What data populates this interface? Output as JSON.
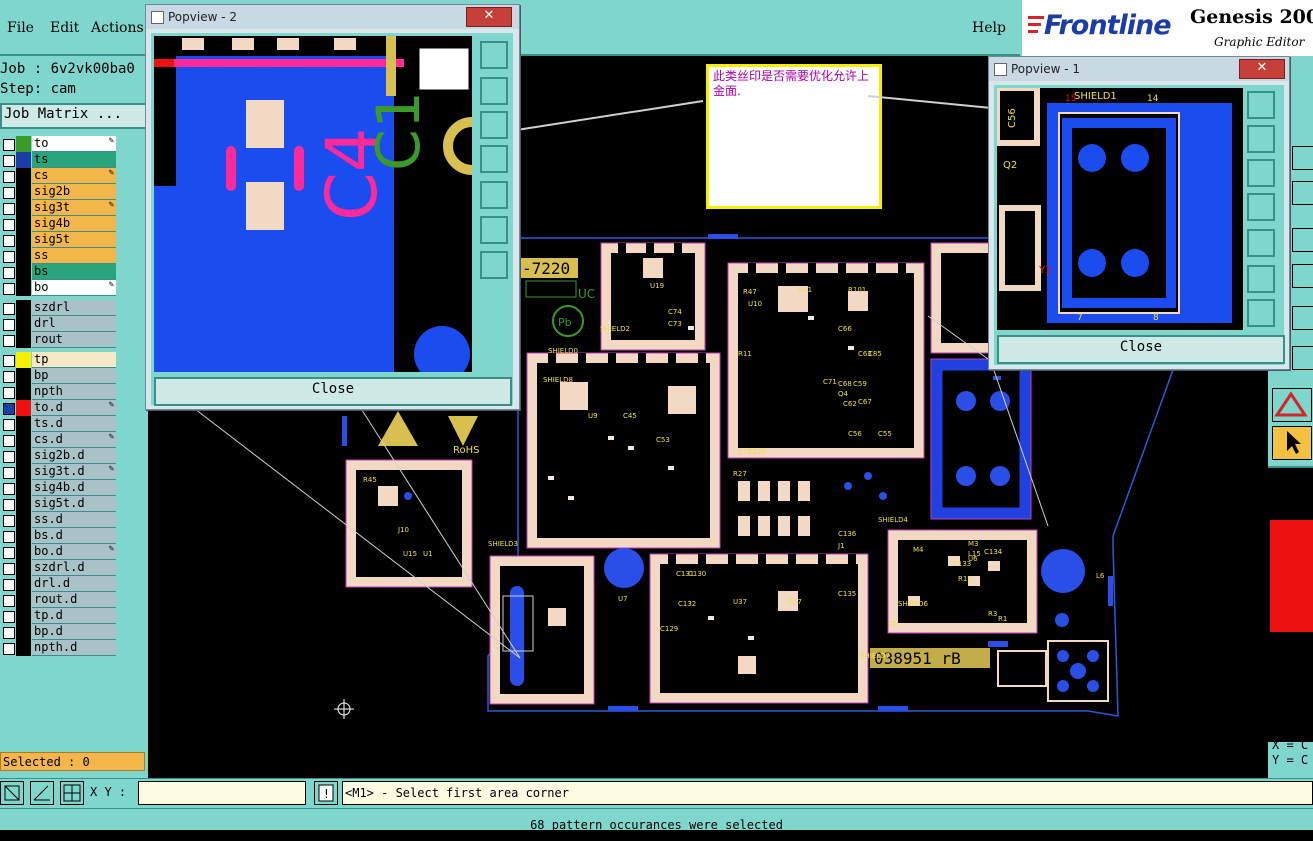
{
  "menu": {
    "file": "File",
    "edit": "Edit",
    "actions": "Actions",
    "help": "Help"
  },
  "brand": {
    "logo": "Frontline",
    "product": "Genesis 200",
    "subtitle": "Graphic Editor"
  },
  "job": {
    "job_line": "Job : 6v2vk00ba0",
    "step_line": "Step: cam",
    "matrix_button": "Job Matrix ..."
  },
  "layers": [
    {
      "name": "to",
      "color": "#3a9a2a",
      "bg": "#ffffff",
      "flag": "✎"
    },
    {
      "name": "ts",
      "color": "#1a3da8",
      "bg": "#2aa47a",
      "flag": ""
    },
    {
      "name": "cs",
      "color": "",
      "bg": "#f2b64a",
      "flag": "✎"
    },
    {
      "name": "sig2b",
      "color": "",
      "bg": "#f2b64a",
      "flag": ""
    },
    {
      "name": "sig3t",
      "color": "",
      "bg": "#f2b64a",
      "flag": "✎"
    },
    {
      "name": "sig4b",
      "color": "",
      "bg": "#f2b64a",
      "flag": ""
    },
    {
      "name": "sig5t",
      "color": "",
      "bg": "#f2b64a",
      "flag": ""
    },
    {
      "name": "ss",
      "color": "",
      "bg": "#f2b64a",
      "flag": ""
    },
    {
      "name": "bs",
      "color": "",
      "bg": "#2aa47a",
      "flag": ""
    },
    {
      "name": "bo",
      "color": "",
      "bg": "#ffffff",
      "flag": "✎"
    },
    {
      "name": "szdrl",
      "color": "",
      "bg": "#a9c2c8",
      "flag": ""
    },
    {
      "name": "drl",
      "color": "",
      "bg": "#a9c2c8",
      "flag": ""
    },
    {
      "name": "rout",
      "color": "",
      "bg": "#a9c2c8",
      "flag": ""
    },
    {
      "name": "tp",
      "color": "#f4f000",
      "bg": "#f5e9c7",
      "flag": ""
    },
    {
      "name": "bp",
      "color": "",
      "bg": "#a9c2c8",
      "flag": ""
    },
    {
      "name": "npth",
      "color": "",
      "bg": "#a9c2c8",
      "flag": ""
    },
    {
      "name": "to.d",
      "color": "#ee1111",
      "bg": "#a9c2c8",
      "flag": "✎"
    },
    {
      "name": "ts.d",
      "color": "",
      "bg": "#a9c2c8",
      "flag": ""
    },
    {
      "name": "cs.d",
      "color": "",
      "bg": "#a9c2c8",
      "flag": "✎"
    },
    {
      "name": "sig2b.d",
      "color": "",
      "bg": "#a9c2c8",
      "flag": ""
    },
    {
      "name": "sig3t.d",
      "color": "",
      "bg": "#a9c2c8",
      "flag": "✎"
    },
    {
      "name": "sig4b.d",
      "color": "",
      "bg": "#a9c2c8",
      "flag": ""
    },
    {
      "name": "sig5t.d",
      "color": "",
      "bg": "#a9c2c8",
      "flag": ""
    },
    {
      "name": "ss.d",
      "color": "",
      "bg": "#a9c2c8",
      "flag": ""
    },
    {
      "name": "bs.d",
      "color": "",
      "bg": "#a9c2c8",
      "flag": ""
    },
    {
      "name": "bo.d",
      "color": "",
      "bg": "#a9c2c8",
      "flag": "✎"
    },
    {
      "name": "szdrl.d",
      "color": "",
      "bg": "#a9c2c8",
      "flag": ""
    },
    {
      "name": "drl.d",
      "color": "",
      "bg": "#a9c2c8",
      "flag": ""
    },
    {
      "name": "rout.d",
      "color": "",
      "bg": "#a9c2c8",
      "flag": ""
    },
    {
      "name": "tp.d",
      "color": "",
      "bg": "#a9c2c8",
      "flag": ""
    },
    {
      "name": "bp.d",
      "color": "",
      "bg": "#a9c2c8",
      "flag": ""
    },
    {
      "name": "npth.d",
      "color": "",
      "bg": "#a9c2c8",
      "flag": ""
    }
  ],
  "selected": "Selected : 0",
  "cmd": {
    "xy_label": "X Y :",
    "xy_value": "",
    "prompt": "<M1> - Select first area corner"
  },
  "status": "68 pattern occurances were selected",
  "popview2": {
    "title": "Popview - 2",
    "close": "Close"
  },
  "popview1": {
    "title": "Popview - 1",
    "close": "Close"
  },
  "annotation": "此类丝印是否需要优化允许上金面.",
  "coords": {
    "x": "X = C",
    "y": "Y = C"
  },
  "board": {
    "part_no": "-7220",
    "serial": "038951 rB",
    "rohs": "RoHS",
    "uc": "UC",
    "labels": [
      "U19",
      "C74",
      "C73",
      "SHIELD2",
      "SHIELD0",
      "SHIELD3",
      "SHIELD4",
      "SHIELD6",
      "SHIELD7",
      "SHIELD8",
      "U9",
      "C45",
      "C53",
      "U10",
      "U11",
      "R101",
      "C66",
      "Q4",
      "C62",
      "C67",
      "C59",
      "C68",
      "C71",
      "R47",
      "R45",
      "J10",
      "U15",
      "U1",
      "C6",
      "R3",
      "R1",
      "U6",
      "C133",
      "C131",
      "C130",
      "C132",
      "C129",
      "U37",
      "C57",
      "L6",
      "U7",
      "J1",
      "M4",
      "M3",
      "R12",
      "C134",
      "C135",
      "C136",
      "L15",
      "R27",
      "C127",
      "C128",
      "C56",
      "C55",
      "C63",
      "C85",
      "R11"
    ],
    "popview1_labels": [
      "C56",
      "Q2",
      "SHIELD1",
      "14",
      "15",
      "Y1",
      "7",
      "8"
    ],
    "popview2_labels": [
      "C1",
      "C4"
    ]
  }
}
